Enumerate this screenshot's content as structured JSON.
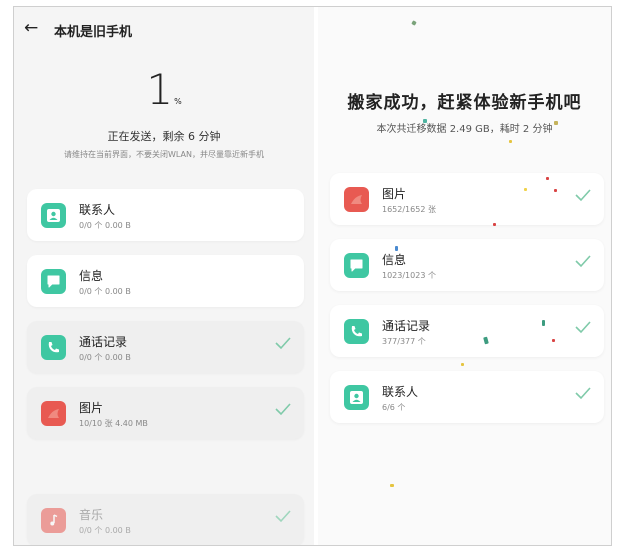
{
  "left": {
    "title": "本机是旧手机",
    "back_icon": "arrow-left-icon",
    "percent": "1",
    "percent_sign": "%",
    "status": "正在发送，剩余 6 分钟",
    "hint": "请维持在当前界面，不要关闭WLAN，并尽量靠近新手机",
    "items": [
      {
        "title": "联系人",
        "sub": "0/0 个    0.00 B",
        "icon": "contact-icon",
        "done": false
      },
      {
        "title": "信息",
        "sub": "0/0 个    0.00 B",
        "icon": "message-icon",
        "done": false
      },
      {
        "title": "通话记录",
        "sub": "0/0 个    0.00 B",
        "icon": "phone-icon",
        "done": true
      },
      {
        "title": "图片",
        "sub": "10/10 张    4.40 MB",
        "icon": "photo-icon",
        "done": true
      },
      {
        "title": "音乐",
        "sub": "0/0 个    0.00 B",
        "icon": "music-icon",
        "done": true
      }
    ]
  },
  "right": {
    "title": "搬家成功，赶紧体验新手机吧",
    "sub": "本次共迁移数据 2.49 GB，耗时 2 分钟",
    "items": [
      {
        "title": "图片",
        "sub": "1652/1652 张",
        "icon": "photo-icon"
      },
      {
        "title": "信息",
        "sub": "1023/1023 个",
        "icon": "message-icon"
      },
      {
        "title": "通话记录",
        "sub": "377/377 个",
        "icon": "phone-icon"
      },
      {
        "title": "联系人",
        "sub": "6/6 个",
        "icon": "contact-icon"
      }
    ]
  },
  "colors": {
    "accent_green": "#3fc7a2",
    "accent_red": "#e85a52",
    "check": "#7fcaa9"
  }
}
